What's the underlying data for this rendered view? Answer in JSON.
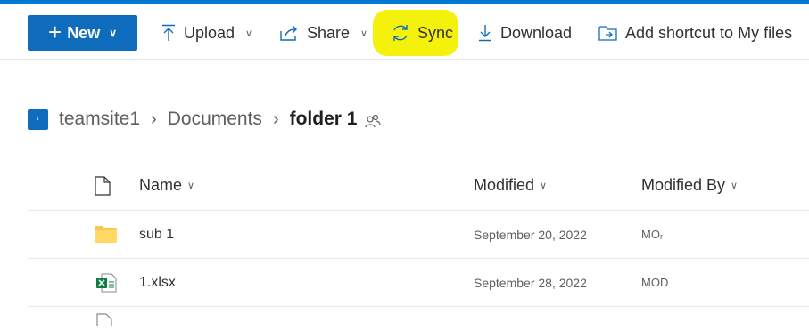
{
  "toolbar": {
    "new_label": "New",
    "upload_label": "Upload",
    "share_label": "Share",
    "sync_label": "Sync",
    "download_label": "Download",
    "shortcut_label": "Add shortcut to My files"
  },
  "breadcrumb": {
    "site_logo_text": "t",
    "site": "teamsite1",
    "library": "Documents",
    "current": "folder 1"
  },
  "columns": {
    "name": "Name",
    "modified": "Modified",
    "modified_by": "Modified By"
  },
  "rows": [
    {
      "icon": "folder-icon",
      "name": "sub 1",
      "modified": "September 20, 2022",
      "modified_by": "MOᵣ"
    },
    {
      "icon": "excel-file-icon",
      "name": "1.xlsx",
      "modified": "September 28, 2022",
      "modified_by": "MOD"
    }
  ],
  "colors": {
    "accent": "#0f6cbd",
    "highlight": "#f4f20a",
    "folder": "#f8c74d",
    "excel": "#107c41"
  }
}
